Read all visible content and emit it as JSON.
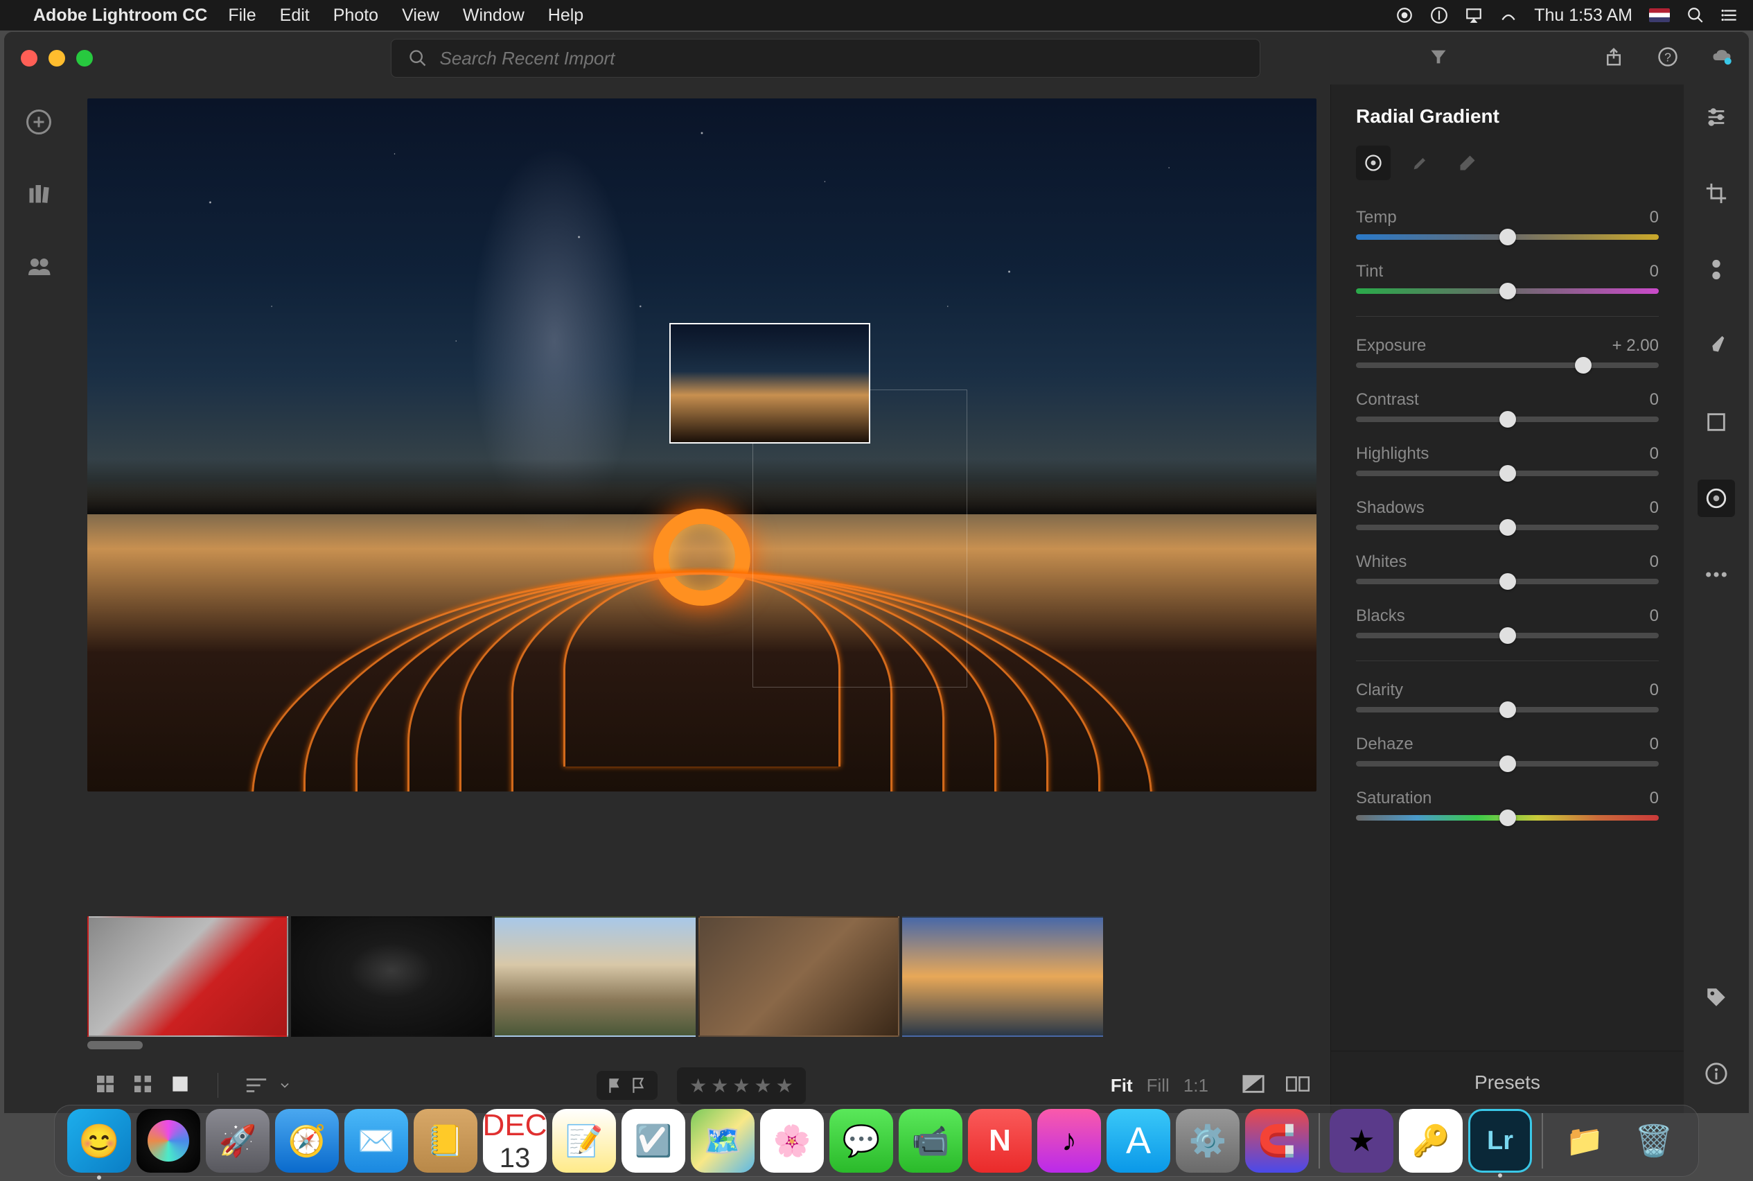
{
  "menubar": {
    "app_name": "Adobe Lightroom CC",
    "menus": [
      "File",
      "Edit",
      "Photo",
      "View",
      "Window",
      "Help"
    ],
    "clock": "Thu 1:53 AM"
  },
  "toolbar": {
    "search_placeholder": "Search Recent Import"
  },
  "panel": {
    "title": "Radial Gradient",
    "sliders": [
      {
        "label": "Temp",
        "value": "0",
        "pos": 50,
        "track": "tr-temp"
      },
      {
        "label": "Tint",
        "value": "0",
        "pos": 50,
        "track": "tr-tint"
      },
      {
        "label": "Exposure",
        "value": "+ 2.00",
        "pos": 75,
        "track": "tr-gray"
      },
      {
        "label": "Contrast",
        "value": "0",
        "pos": 50,
        "track": "tr-gray"
      },
      {
        "label": "Highlights",
        "value": "0",
        "pos": 50,
        "track": "tr-gray"
      },
      {
        "label": "Shadows",
        "value": "0",
        "pos": 50,
        "track": "tr-gray"
      },
      {
        "label": "Whites",
        "value": "0",
        "pos": 50,
        "track": "tr-gray"
      },
      {
        "label": "Blacks",
        "value": "0",
        "pos": 50,
        "track": "tr-gray"
      },
      {
        "label": "Clarity",
        "value": "0",
        "pos": 50,
        "track": "tr-gray"
      },
      {
        "label": "Dehaze",
        "value": "0",
        "pos": 50,
        "track": "tr-gray"
      },
      {
        "label": "Saturation",
        "value": "0",
        "pos": 50,
        "track": "tr-sat"
      }
    ],
    "presets_label": "Presets"
  },
  "bottombar": {
    "zoom": {
      "fit": "Fit",
      "fill": "Fill",
      "one": "1:1"
    }
  },
  "calendar": {
    "month": "DEC",
    "day": "13"
  },
  "thumbnails": [
    {
      "name": "thumb-car",
      "cls": "t1"
    },
    {
      "name": "thumb-apple",
      "cls": "t2"
    },
    {
      "name": "thumb-mountain",
      "cls": "t3"
    },
    {
      "name": "thumb-coffee",
      "cls": "t4"
    },
    {
      "name": "thumb-sunset",
      "cls": "t5"
    },
    {
      "name": "thumb-sparks",
      "cls": "t6",
      "selected": true
    }
  ]
}
